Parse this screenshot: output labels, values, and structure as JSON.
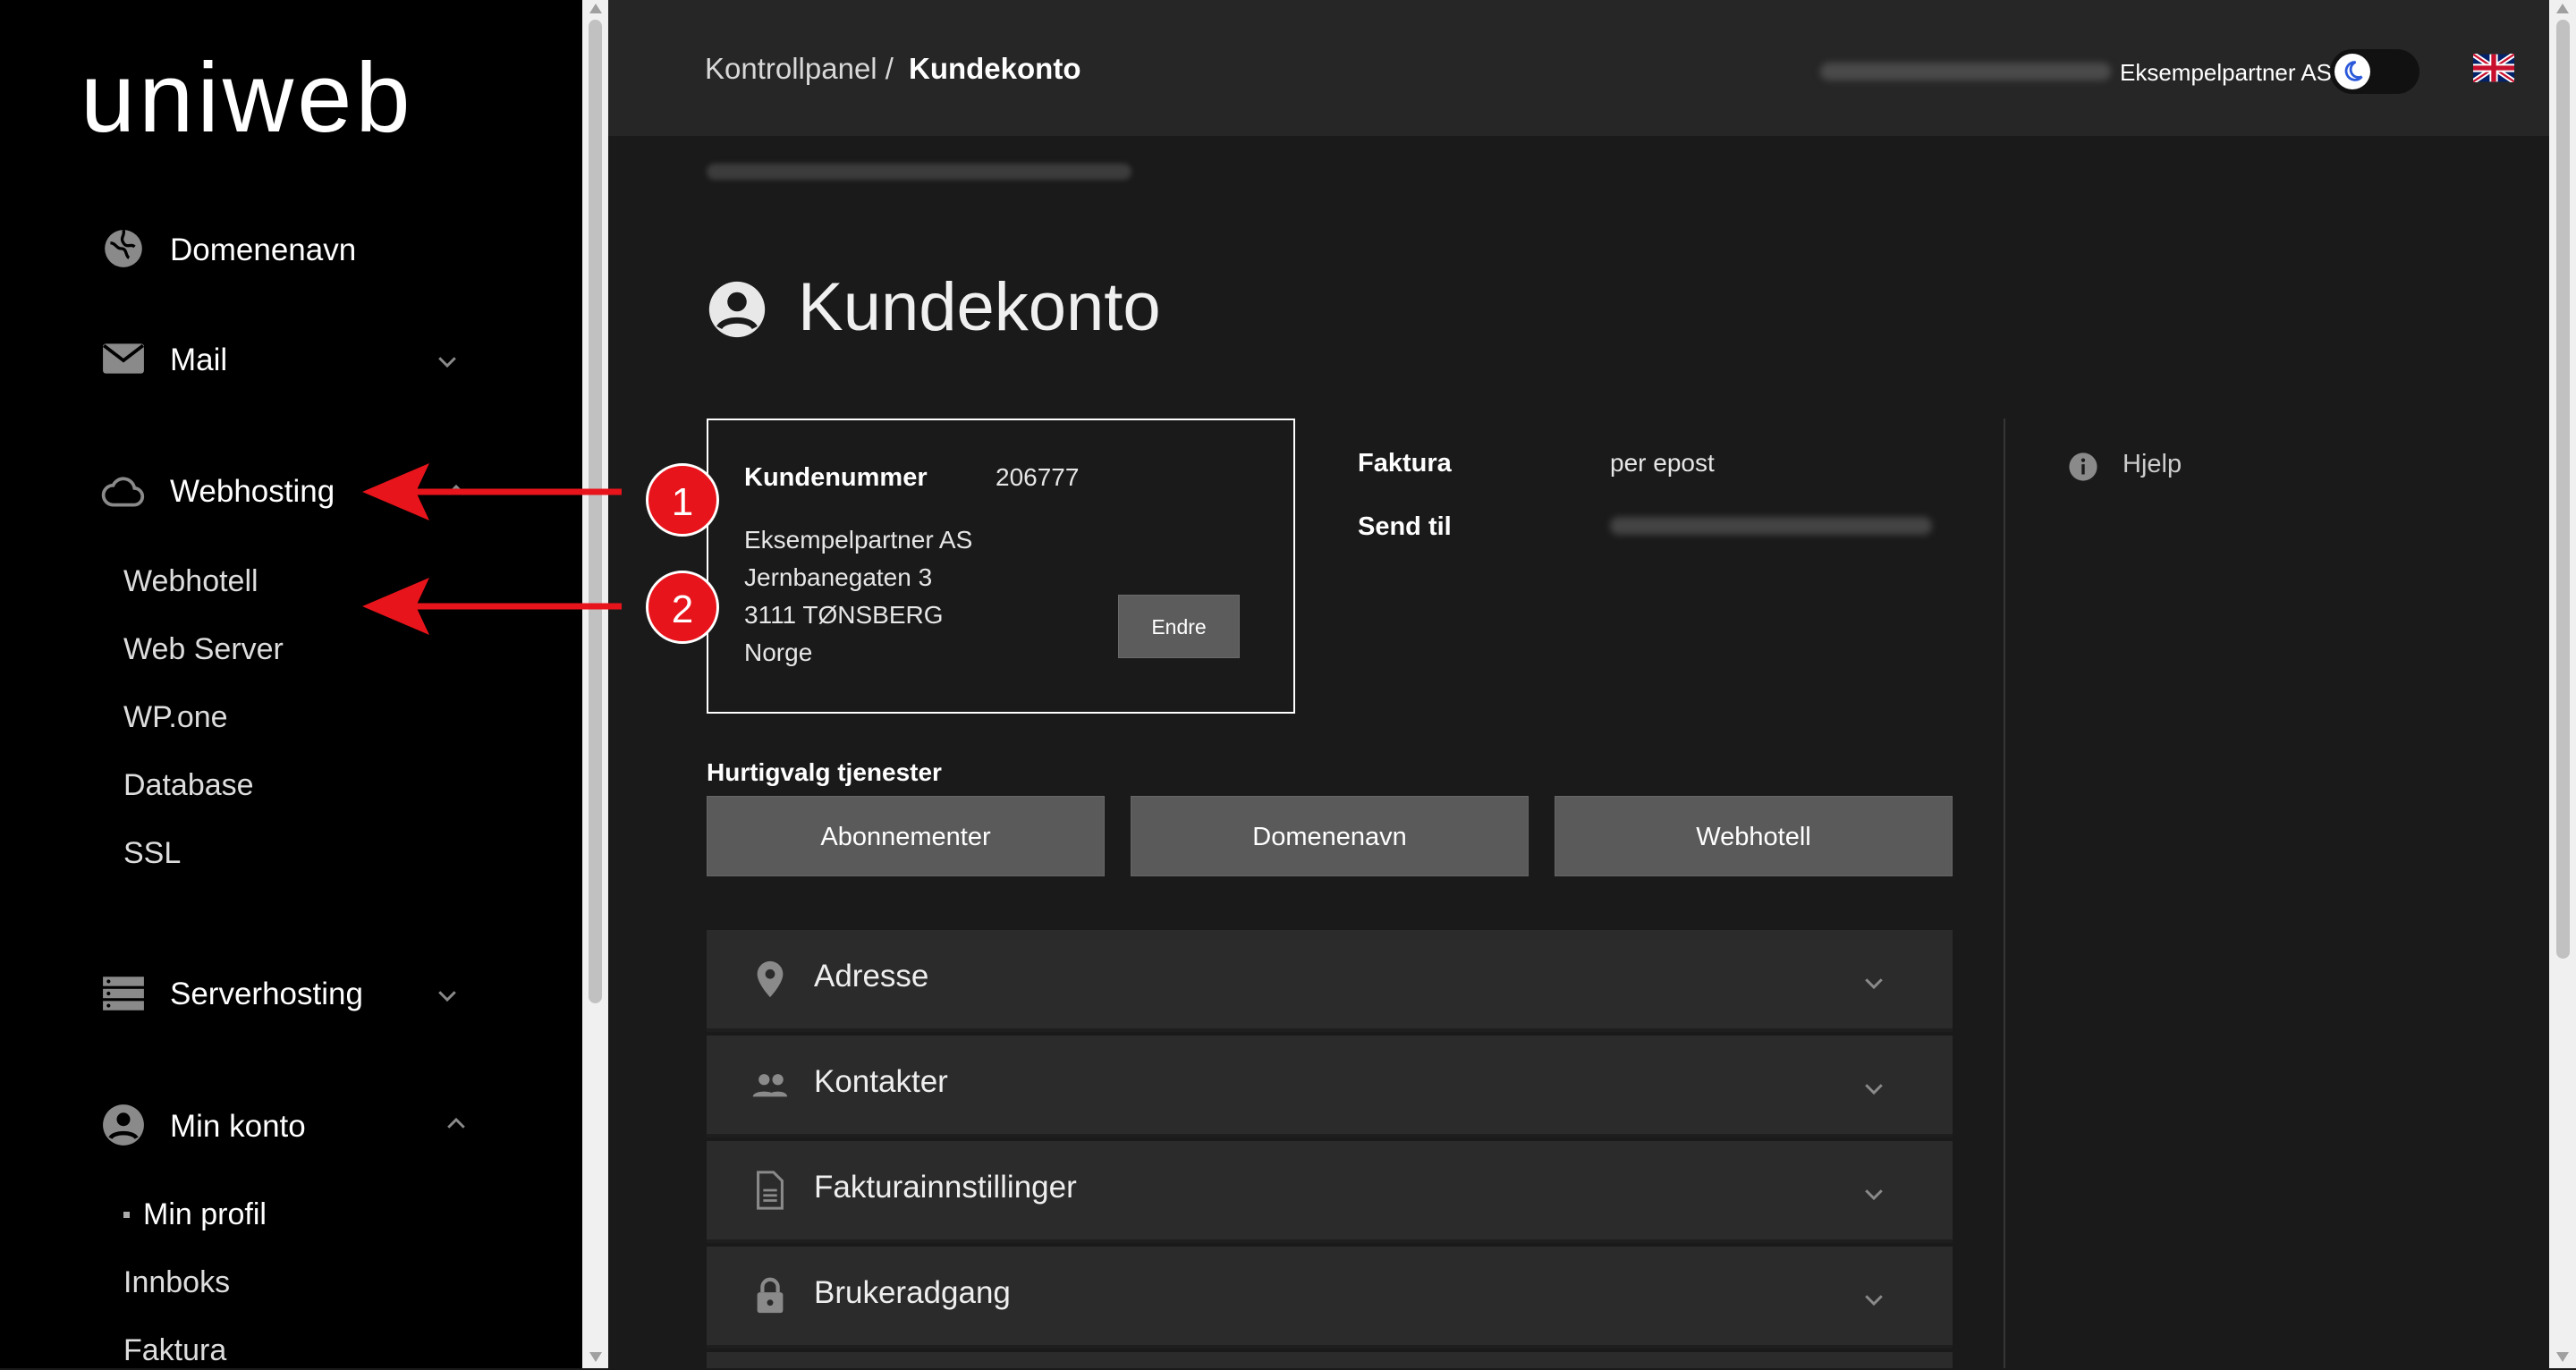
{
  "brand": {
    "logo": "uniweb"
  },
  "sidebar": {
    "items": [
      {
        "label": "Domenenavn",
        "icon": "globe-icon"
      },
      {
        "label": "Mail",
        "icon": "mail-icon"
      },
      {
        "label": "Webhosting",
        "icon": "cloud-icon"
      },
      {
        "label": "Serverhosting",
        "icon": "server-icon"
      },
      {
        "label": "Min konto",
        "icon": "account-circle-icon"
      }
    ],
    "webhosting_sub": [
      "Webhotell",
      "Web Server",
      "WP.one",
      "Database",
      "SSL"
    ],
    "minkonto_sub": [
      "Min profil",
      "Innboks",
      "Faktura"
    ]
  },
  "header": {
    "breadcrumb_root": "Kontrollpanel /",
    "breadcrumb_current": "Kundekonto",
    "partner": "Eksempelpartner AS",
    "theme_toggle_icon": "moon-icon",
    "language_icon": "uk-flag-icon"
  },
  "page": {
    "title": "Kundekonto",
    "title_icon": "account-circle-icon"
  },
  "customer": {
    "number_label": "Kundenummer",
    "number": "206777",
    "name": "Eksempelpartner AS",
    "street": "Jernbanegaten 3",
    "city": "3111 TØNSBERG",
    "country": "Norge",
    "edit_label": "Endre"
  },
  "invoice": {
    "faktura_label": "Faktura",
    "faktura_value": "per epost",
    "send_label": "Send til"
  },
  "help": {
    "label": "Hjelp",
    "icon": "info-icon"
  },
  "quick": {
    "title": "Hurtigvalg tjenester",
    "buttons": [
      "Abonnementer",
      "Domenenavn",
      "Webhotell"
    ]
  },
  "accordion": [
    {
      "label": "Adresse",
      "icon": "location-pin-icon"
    },
    {
      "label": "Kontakter",
      "icon": "people-icon"
    },
    {
      "label": "Fakturainnstillinger",
      "icon": "document-icon"
    },
    {
      "label": "Brukeradgang",
      "icon": "lock-icon"
    }
  ],
  "annotations": {
    "badge1": "1",
    "badge2": "2",
    "color": "#e8141b"
  }
}
